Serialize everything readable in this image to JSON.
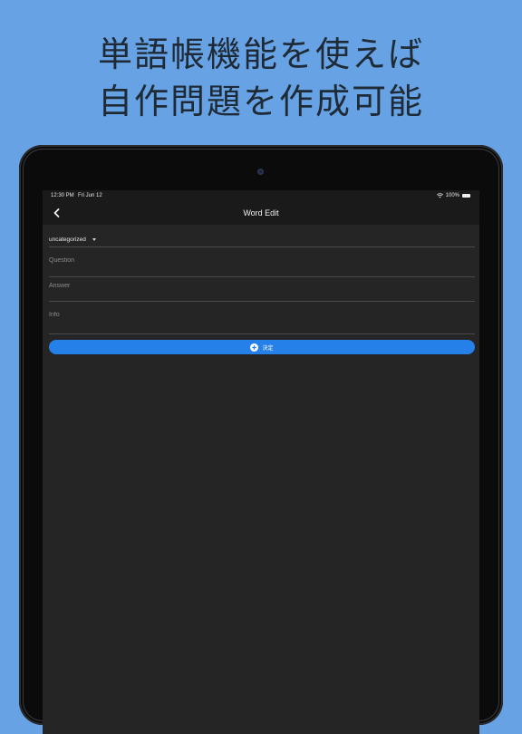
{
  "promo": {
    "line1": "単語帳機能を使えば",
    "line2": "自作問題を作成可能"
  },
  "status_bar": {
    "time": "12:30 PM",
    "date": "Fri Jun 12",
    "battery": "100%"
  },
  "nav": {
    "title": "Word Edit",
    "back_icon": "chevron-left-icon"
  },
  "form": {
    "category": "uncategorized",
    "question_placeholder": "Question",
    "answer_placeholder": "Answer",
    "info_placeholder": "Info",
    "submit_label": "決定"
  },
  "colors": {
    "background": "#67a3e4",
    "screen": "#252525",
    "accent": "#2680ea"
  }
}
